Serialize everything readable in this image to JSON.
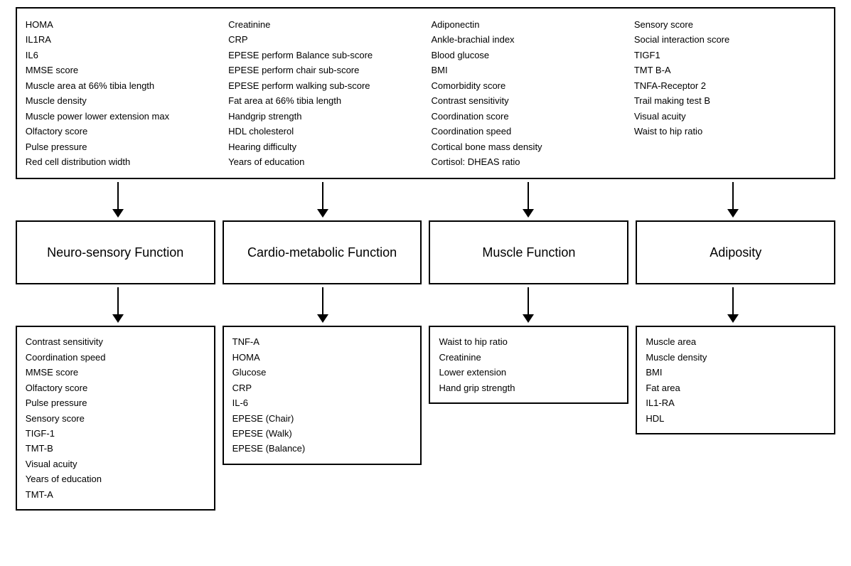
{
  "top_box": {
    "col1": [
      "HOMA",
      "IL1RA",
      "IL6",
      "MMSE score",
      "Muscle area at 66% tibia length",
      "Muscle density",
      "Muscle power lower extension max",
      "Olfactory score",
      "Pulse pressure",
      "Red cell distribution width"
    ],
    "col2": [
      "Creatinine",
      "CRP",
      "EPESE perform Balance sub-score",
      "EPESE perform chair sub-score",
      "EPESE perform walking sub-score",
      "Fat area at 66% tibia length",
      "Handgrip strength",
      "HDL cholesterol",
      "Hearing difficulty",
      "Years of education"
    ],
    "col3": [
      "Adiponectin",
      "Ankle-brachial index",
      "Blood glucose",
      "BMI",
      "Comorbidity score",
      "Contrast sensitivity",
      "Coordination score",
      "Coordination speed",
      "Cortical bone mass density",
      "Cortisol: DHEAS ratio"
    ],
    "col4": [
      "Sensory score",
      "Social interaction score",
      "TIGF1",
      "TMT B-A",
      "TNFA-Receptor 2",
      "Trail making test B",
      "Visual acuity",
      "Waist to hip ratio"
    ]
  },
  "categories": [
    {
      "label": "Neuro-sensory\nFunction"
    },
    {
      "label": "Cardio-metabolic\nFunction"
    },
    {
      "label": "Muscle Function"
    },
    {
      "label": "Adiposity"
    }
  ],
  "detail_boxes": [
    {
      "items": [
        "Contrast sensitivity",
        "Coordination speed",
        "MMSE score",
        "Olfactory score",
        "Pulse pressure",
        "Sensory score",
        "TIGF-1",
        "TMT-B",
        "Visual acuity",
        "Years of education",
        "TMT-A"
      ]
    },
    {
      "items": [
        "TNF-A",
        "HOMA",
        "Glucose",
        "CRP",
        "IL-6",
        "EPESE (Chair)",
        "EPESE (Walk)",
        "EPESE (Balance)"
      ]
    },
    {
      "items": [
        "Waist to hip ratio",
        "Creatinine",
        "Lower extension",
        "Hand grip strength"
      ]
    },
    {
      "items": [
        "Muscle area",
        "Muscle density",
        "BMI",
        "Fat area",
        "IL1-RA",
        "HDL"
      ]
    }
  ]
}
